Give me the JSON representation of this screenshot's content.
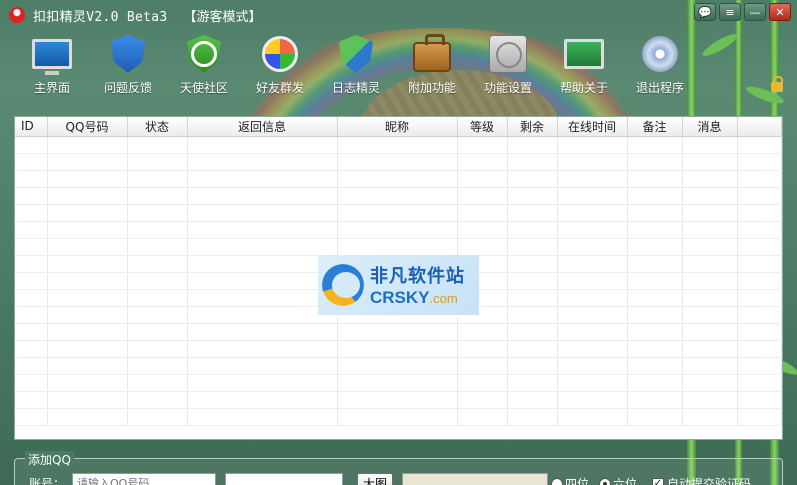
{
  "titlebar": {
    "app_title": "扣扣精灵V2.0 Beta3",
    "mode": "【游客模式】"
  },
  "toolbar": {
    "items": [
      {
        "label": "主界面",
        "icon": "monitor-icon"
      },
      {
        "label": "问题反馈",
        "icon": "shield-lightning-icon"
      },
      {
        "label": "天使社区",
        "icon": "shield-clock-icon"
      },
      {
        "label": "好友群发",
        "icon": "globe-refresh-icon"
      },
      {
        "label": "日志精灵",
        "icon": "shield-check-icon"
      },
      {
        "label": "附加功能",
        "icon": "briefcase-icon"
      },
      {
        "label": "功能设置",
        "icon": "disk-tools-icon"
      },
      {
        "label": "帮助关于",
        "icon": "monitor-check-icon"
      },
      {
        "label": "退出程序",
        "icon": "disc-icon"
      }
    ]
  },
  "table": {
    "columns": [
      "ID",
      "QQ号码",
      "状态",
      "返回信息",
      "昵称",
      "等级",
      "剩余",
      "在线时间",
      "备注",
      "消息"
    ]
  },
  "watermark": {
    "cn": "非凡软件站",
    "en_main": "CRSKY",
    "en_suffix": ".com"
  },
  "add_group": {
    "title": "添加QQ",
    "account_label": "账号：",
    "account_placeholder": "请输入QQ号码",
    "big_button": "大图",
    "radio_four": "四位",
    "radio_six": "六位",
    "auto_submit": "自动提交验证码"
  },
  "colors": {
    "background": "#4a7a63",
    "close_button": "#c9392a"
  }
}
